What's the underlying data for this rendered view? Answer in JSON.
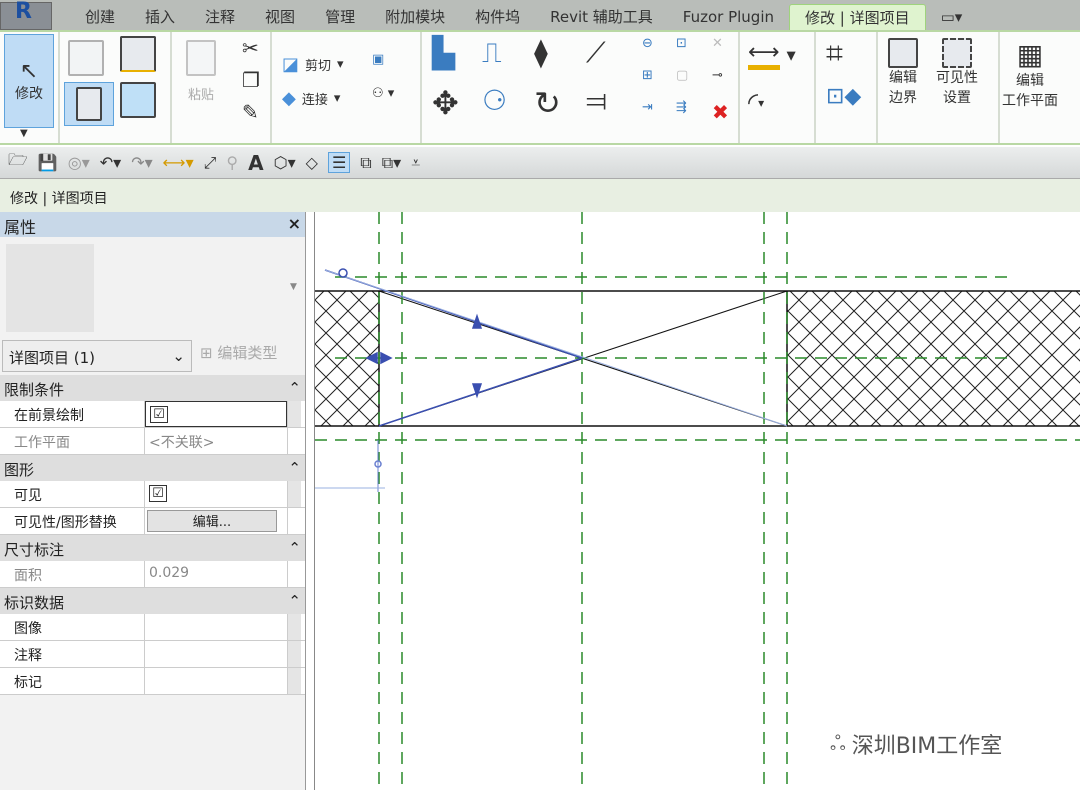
{
  "tabs": [
    "创建",
    "插入",
    "注释",
    "视图",
    "管理",
    "附加模块",
    "构件坞",
    "Revit 辅助工具",
    "Fuzor Plugin",
    "修改 | 详图项目"
  ],
  "ribbon": {
    "modify": "修改",
    "paste": "粘贴",
    "cut": "剪切",
    "join": "连接",
    "edit_boundary": [
      "编辑",
      "边界"
    ],
    "visibility": [
      "可见性",
      "设置"
    ],
    "edit_workplane": [
      "编辑",
      "工作平面"
    ]
  },
  "context_bar": "修改 | 详图项目",
  "properties": {
    "title": "属性",
    "close": "×",
    "type_selector": "详图项目 (1)",
    "edit_type": "编辑类型",
    "sections": [
      {
        "name": "限制条件",
        "rows": [
          {
            "k": "在前景绘制",
            "v": "☑"
          },
          {
            "k": "工作平面",
            "v": "<不关联>"
          }
        ]
      },
      {
        "name": "图形",
        "rows": [
          {
            "k": "可见",
            "v": "☑"
          },
          {
            "k": "可见性/图形替换",
            "v": "编辑..."
          }
        ]
      },
      {
        "name": "尺寸标注",
        "rows": [
          {
            "k": "面积",
            "v": "0.029"
          }
        ]
      },
      {
        "name": "标识数据",
        "rows": [
          {
            "k": "图像",
            "v": ""
          },
          {
            "k": "注释",
            "v": ""
          },
          {
            "k": "标记",
            "v": ""
          }
        ]
      }
    ]
  },
  "watermark": "深圳BIM工作室",
  "colors": {
    "grid": "#2a8a2a",
    "selection": "#3a4fb0",
    "ribbon_active": "#bfdcf5"
  }
}
